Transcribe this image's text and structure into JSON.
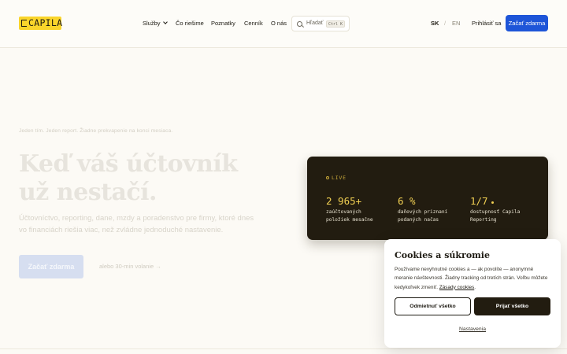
{
  "header": {
    "logo_text": "CAPILA",
    "nav": [
      {
        "label": "Služby",
        "has_dropdown": true
      },
      {
        "label": "Čo riešime"
      },
      {
        "label": "Poznatky"
      },
      {
        "label": "Cenník"
      },
      {
        "label": "O nás"
      }
    ],
    "search": {
      "label": "Hľadať",
      "shortcut": "Ctrl K"
    },
    "languages": {
      "active": "SK",
      "separator": "/",
      "other": "EN"
    },
    "login_label": "Prihlásiť sa",
    "cta_label": "Začať zdarma",
    "cta_color": "#1e55d8"
  },
  "hero": {
    "eyebrow": "Jeden tím. Jeden report. Žiadne prekvapenie na konci mesiaca.",
    "title_line1": "Keď váš účtovník",
    "title_line2": "už nestačí.",
    "lead": "Účtovníctvo, reporting, dane, mzdy a poradenstvo pre firmy, ktoré dnes vo financiách riešia viac, než zvládne jednoduché nastavenie.",
    "cta_label": "Začať zdarma",
    "alt_link": "alebo 30-min volanie →"
  },
  "stats": {
    "badge": "LIVE",
    "items": [
      {
        "value": "2 965+",
        "label_line1": "zaúčtovaných",
        "label_line2": "položiek mesačne"
      },
      {
        "value": "6 %",
        "label_line1": "daňových priznaní",
        "label_line2": "podaných načas"
      },
      {
        "value": "1/7",
        "label_line1": "dostupnosť Capila",
        "label_line2": "Reporting"
      }
    ]
  },
  "cookies": {
    "title": "Cookies a súkromie",
    "text": "Používame nevyhnutné cookies a — ak povolíte — anonymné meranie návštevnosti. Žiadny tracking od tretích strán. Voľbu môžete kedykoľvek zmeniť.",
    "policy_link": "Zásady cookies",
    "reject_label": "Odmietnuť všetko",
    "accept_label": "Prijať všetko",
    "settings_label": "Nastavenia"
  }
}
